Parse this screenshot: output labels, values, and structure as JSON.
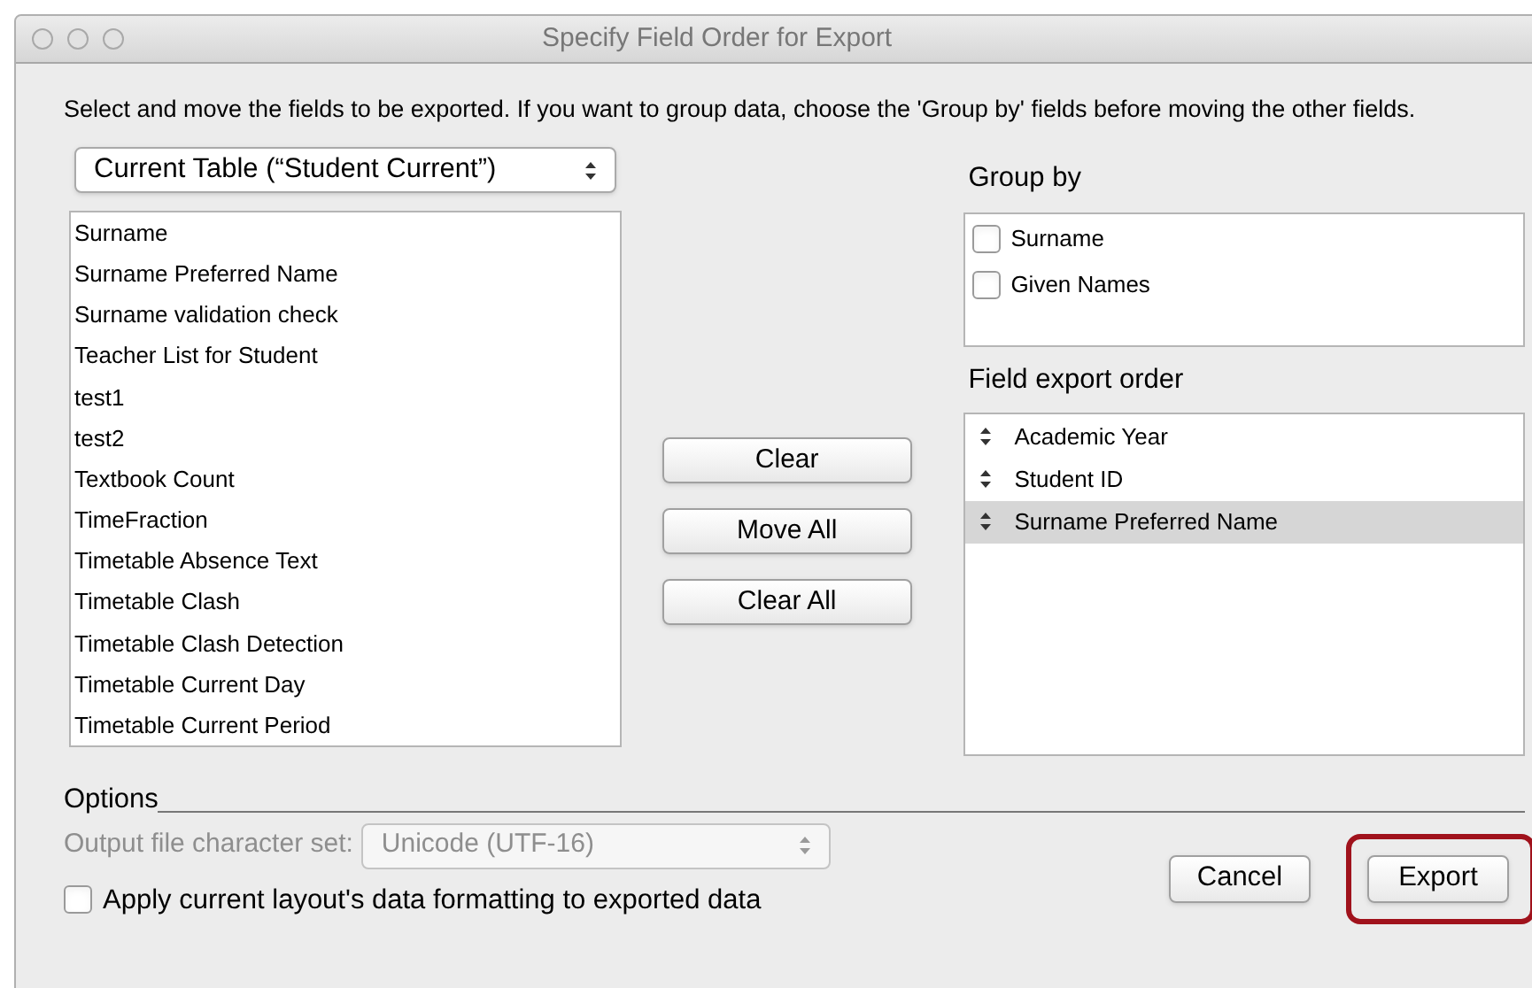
{
  "window": {
    "title": "Specify Field Order for Export"
  },
  "instructions": "Select and move the fields to be exported.  If you want to group data, choose the 'Group by' fields before moving the other fields.",
  "table_select": {
    "value": "Current Table (“Student Current”)"
  },
  "available_fields": [
    {
      "label": "Surname",
      "selected": false
    },
    {
      "label": "Surname Preferred Name",
      "selected": false
    },
    {
      "label": "Surname validation check",
      "selected": false
    },
    {
      "label": "Teacher List for Student",
      "selected": false
    },
    {
      "label": "test1",
      "selected": false
    },
    {
      "label": "test2",
      "selected": false
    },
    {
      "label": "Textbook Count",
      "selected": false
    },
    {
      "label": "TimeFraction",
      "selected": false
    },
    {
      "label": "Timetable Absence Text",
      "selected": false
    },
    {
      "label": "Timetable Clash",
      "selected": false
    },
    {
      "label": "Timetable Clash Detection",
      "selected": false
    },
    {
      "label": "Timetable Current Day",
      "selected": false
    },
    {
      "label": "Timetable Current Period",
      "selected": false
    }
  ],
  "middle_buttons": [
    "Clear",
    "Move All",
    "Clear All"
  ],
  "group_by": {
    "title": "Group by",
    "items": [
      {
        "label": "Surname",
        "checked": false
      },
      {
        "label": "Given Names",
        "checked": false
      }
    ]
  },
  "export_order": {
    "title": "Field export order",
    "items": [
      {
        "label": "Academic Year",
        "selected": false
      },
      {
        "label": "Student ID",
        "selected": false
      },
      {
        "label": "Surname Preferred Name",
        "selected": true
      }
    ]
  },
  "options": {
    "title": "Options",
    "charset_label": "Output file character set:",
    "charset_value": "Unicode (UTF-16)",
    "charset_disabled": true,
    "apply_formatting": {
      "label": "Apply current layout's data formatting to exported data",
      "checked": false
    }
  },
  "buttons": [
    {
      "label": "Cancel",
      "highlighted": false
    },
    {
      "label": "Export",
      "highlighted": true
    }
  ]
}
